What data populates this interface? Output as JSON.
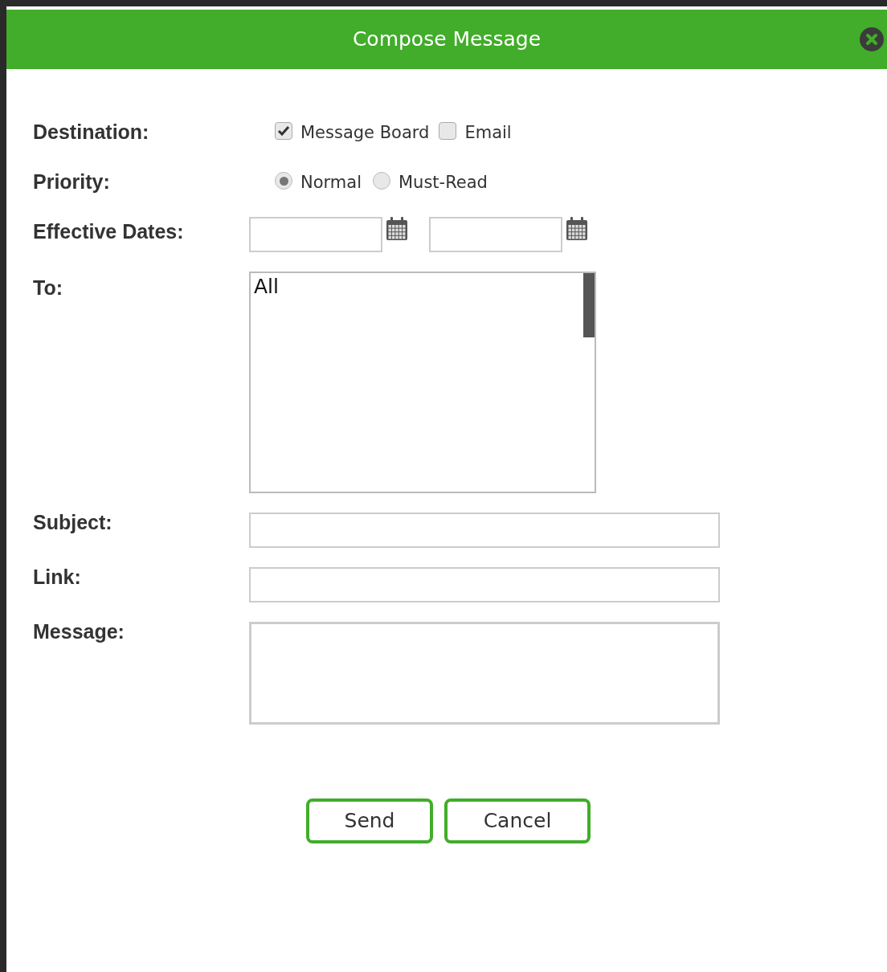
{
  "dialog": {
    "title": "Compose Message"
  },
  "destination": {
    "label": "Destination:",
    "options": [
      {
        "label": "Message Board",
        "checked": true
      },
      {
        "label": "Email",
        "checked": false
      }
    ]
  },
  "priority": {
    "label": "Priority:",
    "options": [
      {
        "label": "Normal",
        "selected": true
      },
      {
        "label": "Must-Read",
        "selected": false
      }
    ]
  },
  "effective_dates": {
    "label": "Effective Dates:"
  },
  "to": {
    "label": "To:",
    "items": [
      "All"
    ]
  },
  "subject": {
    "label": "Subject:"
  },
  "link": {
    "label": "Link:"
  },
  "message": {
    "label": "Message:"
  },
  "buttons": [
    "Send",
    "Cancel"
  ]
}
